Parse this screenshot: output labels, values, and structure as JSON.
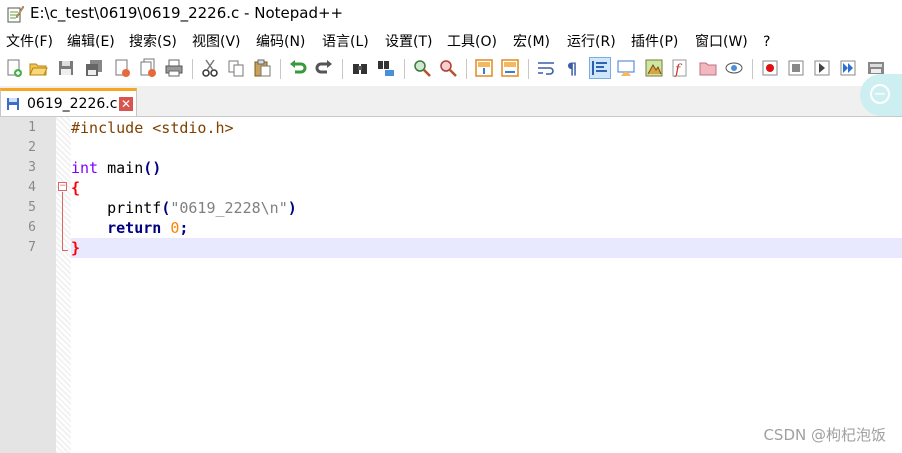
{
  "window": {
    "title": "E:\\c_test\\0619\\0619_2226.c - Notepad++"
  },
  "menu": [
    "文件(F)",
    "编辑(E)",
    "搜索(S)",
    "视图(V)",
    "编码(N)",
    "语言(L)",
    "设置(T)",
    "工具(O)",
    "宏(M)",
    "运行(R)",
    "插件(P)",
    "窗口(W)",
    "?"
  ],
  "toolbar_icons": [
    "new-file-icon",
    "open-file-icon",
    "save-icon",
    "save-all-icon",
    "close-icon",
    "close-all-icon",
    "print-icon",
    "cut-icon",
    "copy-icon",
    "paste-icon",
    "undo-icon",
    "redo-icon",
    "find-icon",
    "replace-icon",
    "zoom-in-icon",
    "zoom-out-icon",
    "sync-vertical-icon",
    "sync-horizontal-icon",
    "word-wrap-icon",
    "show-all-chars-icon",
    "indent-guide-icon",
    "udl-icon",
    "doc-map-icon",
    "function-list-icon",
    "folder-workspace-icon",
    "monitor-icon",
    "record-macro-icon",
    "stop-record-icon",
    "play-macro-icon",
    "run-macro-multiple-icon",
    "save-macro-icon"
  ],
  "tab": {
    "label": "0619_2226.c",
    "close": "✕"
  },
  "editor": {
    "line_numbers": [
      "1",
      "2",
      "3",
      "4",
      "5",
      "6",
      "7"
    ],
    "lines": [
      {
        "tokens": [
          {
            "t": "pp",
            "v": "#include <stdio.h>"
          }
        ]
      },
      {
        "tokens": []
      },
      {
        "tokens": [
          {
            "t": "kw",
            "v": "int"
          },
          {
            "t": "txt",
            "v": " main"
          },
          {
            "t": "op",
            "v": "()"
          }
        ]
      },
      {
        "tokens": [
          {
            "t": "brace",
            "v": "{"
          }
        ]
      },
      {
        "tokens": [
          {
            "t": "txt",
            "v": "    printf"
          },
          {
            "t": "op",
            "v": "("
          },
          {
            "t": "str",
            "v": "\"0619_2228\\n\""
          },
          {
            "t": "op",
            "v": ")"
          }
        ]
      },
      {
        "tokens": [
          {
            "t": "txt",
            "v": "    "
          },
          {
            "t": "kwb",
            "v": "return"
          },
          {
            "t": "txt",
            "v": " "
          },
          {
            "t": "num",
            "v": "0"
          },
          {
            "t": "op",
            "v": ";"
          }
        ]
      },
      {
        "tokens": [
          {
            "t": "brace",
            "v": "}"
          }
        ]
      }
    ],
    "current_line": 7
  },
  "watermark": "CSDN @枸杞泡饭"
}
